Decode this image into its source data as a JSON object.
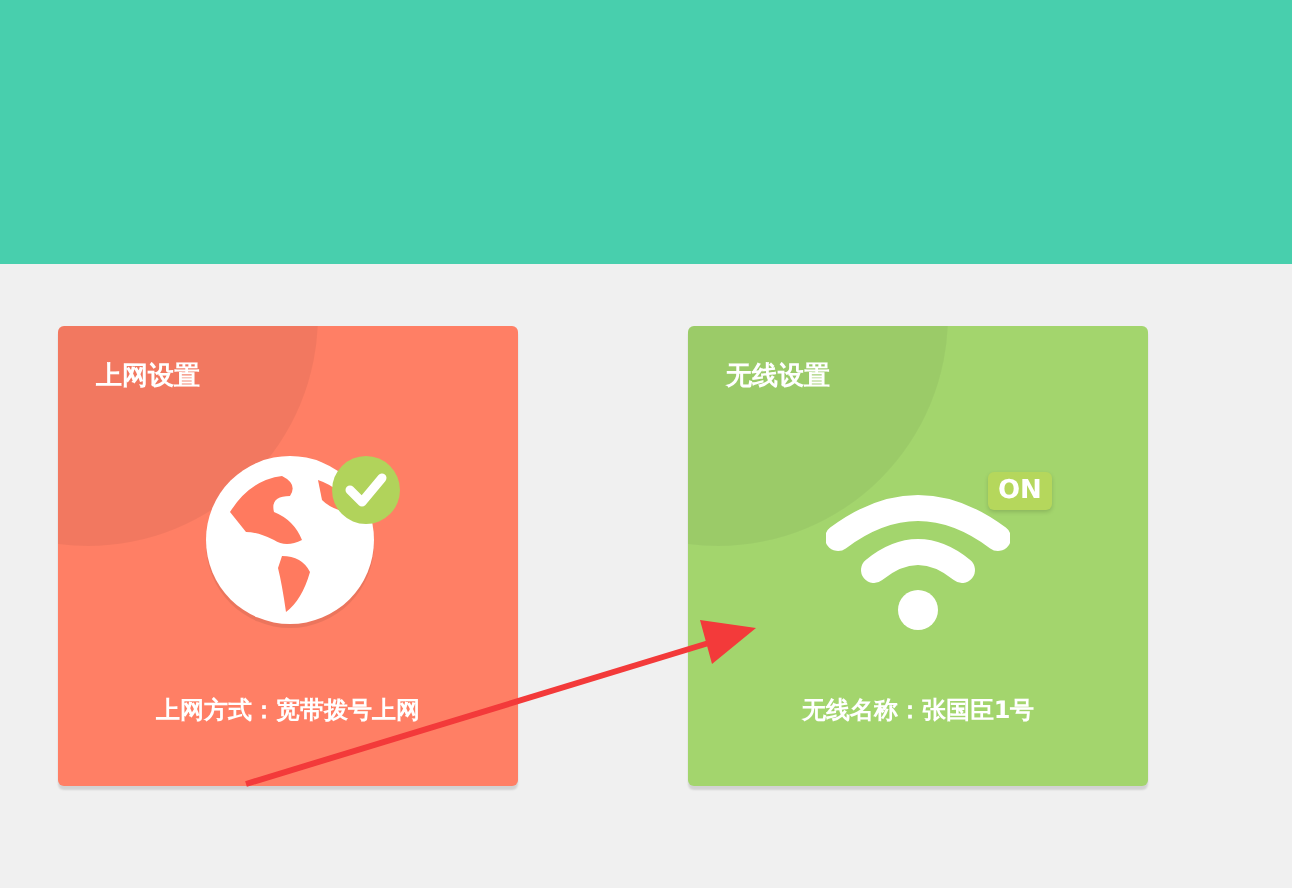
{
  "cards": [
    {
      "kind": "internet",
      "title": "上网设置",
      "detail": "上网方式：宽带拨号上网",
      "connected": true,
      "color": "#ff7a5f"
    },
    {
      "kind": "wireless",
      "title": "无线设置",
      "detail": "无线名称：张国臣1号",
      "badge": "ON",
      "color": "#a0d468"
    }
  ]
}
